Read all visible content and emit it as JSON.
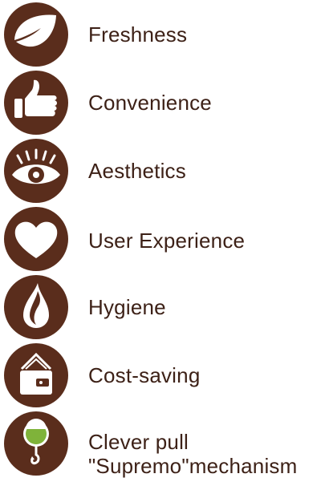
{
  "features": [
    {
      "icon": "leaf-icon",
      "label": "Freshness"
    },
    {
      "icon": "thumbs-up-icon",
      "label": "Convenience"
    },
    {
      "icon": "eye-icon",
      "label": "Aesthetics"
    },
    {
      "icon": "heart-icon",
      "label": "User Experience"
    },
    {
      "icon": "water-drop-icon",
      "label": "Hygiene"
    },
    {
      "icon": "wallet-icon",
      "label": "Cost-saving"
    },
    {
      "icon": "pull-mechanism-icon",
      "label_lines": [
        "Clever pull",
        "\"Supremo\"mechanism"
      ]
    }
  ],
  "colors": {
    "icon_background": "#5a2d1c",
    "icon_foreground": "#ffffff",
    "accent_green": "#7fb33a",
    "text": "#3d2117"
  }
}
